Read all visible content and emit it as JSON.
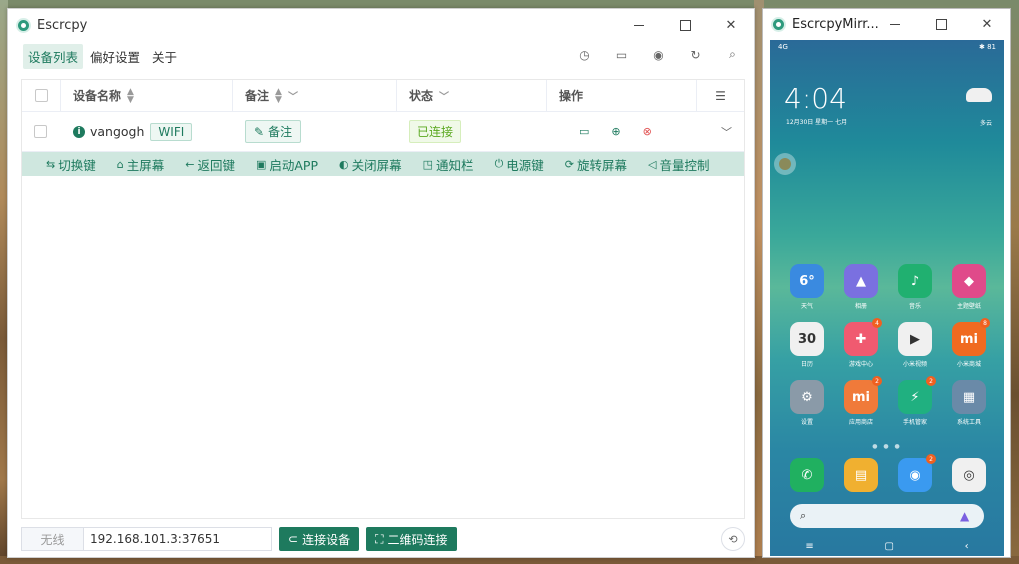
{
  "main_window": {
    "title": "Escrcpy",
    "menu": [
      "设备列表",
      "偏好设置",
      "关于"
    ],
    "table": {
      "headers": [
        "设备名称",
        "备注",
        "状态",
        "操作"
      ],
      "rows": [
        {
          "name": "vangogh",
          "type_tag": "WIFI",
          "note_label": "备注",
          "status": "已连接"
        }
      ]
    },
    "quick_actions": [
      "切换键",
      "主屏幕",
      "返回键",
      "启动APP",
      "关闭屏幕",
      "通知栏",
      "电源键",
      "旋转屏幕",
      "音量控制"
    ],
    "bottom": {
      "wireless_label": "无线",
      "address": "192.168.101.3:37651",
      "connect_button": "连接设备",
      "qr_button": "二维码连接"
    }
  },
  "mirror_window": {
    "title": "EscrcpyMirr...",
    "phone": {
      "status_left": "4G",
      "status_right": "✱ 81",
      "time": "4:04",
      "date": "12月30日 星期一 七月",
      "weather_text": "多云",
      "apps": [
        {
          "label": "天气",
          "glyph": "6°",
          "color": "#3a8ae0",
          "badge": ""
        },
        {
          "label": "相册",
          "glyph": "▲",
          "color": "#7a70e0",
          "badge": ""
        },
        {
          "label": "音乐",
          "glyph": "♪",
          "color": "#20b070",
          "badge": ""
        },
        {
          "label": "主题壁纸",
          "glyph": "◆",
          "color": "#e04a8a",
          "badge": ""
        },
        {
          "label": "日历",
          "glyph": "30",
          "color": "#f0f0f0",
          "badge": ""
        },
        {
          "label": "游戏中心",
          "glyph": "✚",
          "color": "#f05a70",
          "badge": "4"
        },
        {
          "label": "小米视频",
          "glyph": "▶",
          "color": "#f0f0f0",
          "badge": ""
        },
        {
          "label": "小米商城",
          "glyph": "mi",
          "color": "#f06a20",
          "badge": "8"
        },
        {
          "label": "设置",
          "glyph": "⚙",
          "color": "#8a9aa8",
          "badge": ""
        },
        {
          "label": "应用商店",
          "glyph": "mi",
          "color": "#f07a3a",
          "badge": "2"
        },
        {
          "label": "手机管家",
          "glyph": "⚡",
          "color": "#20b080",
          "badge": "2"
        },
        {
          "label": "系统工具",
          "glyph": "▦",
          "color": "#6a8aa8",
          "badge": ""
        }
      ],
      "dock": [
        {
          "glyph": "✆",
          "color": "#20b060",
          "badge": ""
        },
        {
          "glyph": "▤",
          "color": "#f0b030",
          "badge": ""
        },
        {
          "glyph": "◉",
          "color": "#3a9af0",
          "badge": "2"
        },
        {
          "glyph": "◎",
          "color": "#f0f0f0",
          "badge": ""
        }
      ]
    }
  }
}
